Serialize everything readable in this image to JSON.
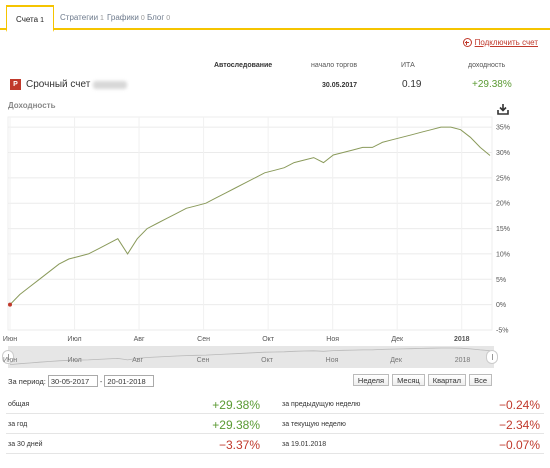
{
  "tabs": [
    {
      "label": "Счета",
      "count": "1"
    },
    {
      "label": "Стратегии",
      "count": "1"
    },
    {
      "label": "Графики",
      "count": "0"
    },
    {
      "label": "Блог",
      "count": "0"
    }
  ],
  "connect_label": "Подключить счет",
  "headers": {
    "autofollow": "Автоследование",
    "start": "начало торгов",
    "ita": "ИТА",
    "yield": "доходность"
  },
  "account": {
    "icon_letter": "P",
    "name": "Срочный счет",
    "start_date": "30.05.2017",
    "ita": "0.19",
    "yield": "+29.38%"
  },
  "chart_title": "Доходность",
  "chart_data": {
    "type": "line",
    "x_labels": [
      "Июн",
      "Июл",
      "Авг",
      "Сен",
      "Окт",
      "Ноя",
      "Дек",
      "2018"
    ],
    "y_ticks": [
      "35%",
      "30%",
      "25%",
      "20%",
      "15%",
      "10%",
      "5%",
      "0%",
      "-5%"
    ],
    "ylim": [
      -5,
      37
    ],
    "grid": true,
    "series": [
      {
        "color": "#8a9a5b",
        "points": [
          [
            0,
            0
          ],
          [
            1,
            2
          ],
          [
            2,
            3.5
          ],
          [
            3,
            5
          ],
          [
            4,
            6.5
          ],
          [
            5,
            8
          ],
          [
            6,
            9
          ],
          [
            7,
            9.5
          ],
          [
            8,
            10
          ],
          [
            9,
            11
          ],
          [
            10,
            12
          ],
          [
            11,
            13
          ],
          [
            12,
            10
          ],
          [
            13,
            13
          ],
          [
            14,
            15
          ],
          [
            15,
            16
          ],
          [
            16,
            17
          ],
          [
            17,
            18
          ],
          [
            18,
            19
          ],
          [
            19,
            19.5
          ],
          [
            20,
            20
          ],
          [
            21,
            21
          ],
          [
            22,
            22
          ],
          [
            23,
            23
          ],
          [
            24,
            24
          ],
          [
            25,
            25
          ],
          [
            26,
            26
          ],
          [
            27,
            26.5
          ],
          [
            28,
            27
          ],
          [
            29,
            28
          ],
          [
            30,
            28.5
          ],
          [
            31,
            29
          ],
          [
            32,
            28
          ],
          [
            33,
            29.5
          ],
          [
            34,
            30
          ],
          [
            35,
            30.5
          ],
          [
            36,
            31
          ],
          [
            37,
            31
          ],
          [
            38,
            32
          ],
          [
            39,
            32.5
          ],
          [
            40,
            33
          ],
          [
            41,
            33.5
          ],
          [
            42,
            34
          ],
          [
            43,
            34.5
          ],
          [
            44,
            35
          ],
          [
            45,
            35
          ],
          [
            46,
            34.5
          ],
          [
            47,
            33
          ],
          [
            48,
            31
          ],
          [
            49,
            29.4
          ]
        ]
      }
    ]
  },
  "navigator_labels": [
    "Июн",
    "Июл",
    "Авг",
    "Сен",
    "Окт",
    "Ноя",
    "Дек",
    "2018"
  ],
  "period": {
    "label": "За период",
    "from": "30-05-2017",
    "to": "20-01-2018",
    "ranges": [
      "Неделя",
      "Месяц",
      "Квартал",
      "Все"
    ]
  },
  "stats": {
    "left": [
      {
        "label": "общая",
        "value": "+29.38%",
        "sign": "pos"
      },
      {
        "label": "за год",
        "value": "+29.38%",
        "sign": "pos"
      },
      {
        "label": "за 30 дней",
        "value": "−3.37%",
        "sign": "neg"
      }
    ],
    "right": [
      {
        "label": "за предыдущую неделю",
        "value": "−0.24%",
        "sign": "neg"
      },
      {
        "label": "за текущую неделю",
        "value": "−2.34%",
        "sign": "neg"
      },
      {
        "label": "за 19.01.2018",
        "value": "−0.07%",
        "sign": "neg"
      }
    ]
  }
}
